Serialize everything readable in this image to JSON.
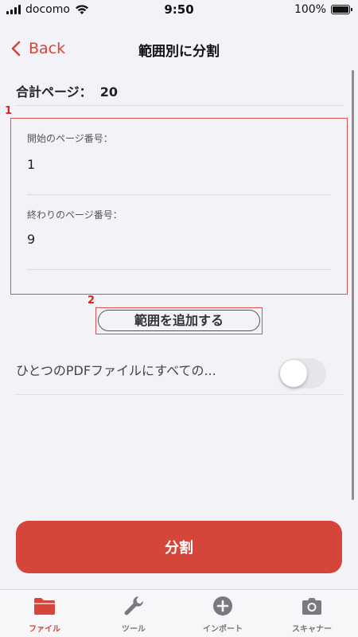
{
  "status_bar": {
    "carrier": "docomo",
    "time": "9:50",
    "battery": "100%"
  },
  "nav": {
    "back_label": "Back",
    "title": "範囲別に分割"
  },
  "total_pages": {
    "label": "合計ページ：",
    "value": "20"
  },
  "range": {
    "marker": "1",
    "start_label": "開始のページ番号：",
    "start_value": "1",
    "end_label": "終わりのページ番号：",
    "end_value": "9"
  },
  "add_range": {
    "marker": "2",
    "label": "範囲を追加する"
  },
  "merge_option": {
    "label": "ひとつのPDFファイルにすべての...",
    "enabled": false
  },
  "split_button": {
    "label": "分割"
  },
  "tabs": [
    {
      "label": "ファイル",
      "icon": "folder-icon",
      "active": true
    },
    {
      "label": "ツール",
      "icon": "wrench-icon",
      "active": false
    },
    {
      "label": "インポート",
      "icon": "plus-circle-icon",
      "active": false
    },
    {
      "label": "スキャナー",
      "icon": "camera-icon",
      "active": false
    }
  ],
  "colors": {
    "accent": "#d6453a",
    "highlight": "#e05050",
    "background": "#f2f2f7"
  }
}
